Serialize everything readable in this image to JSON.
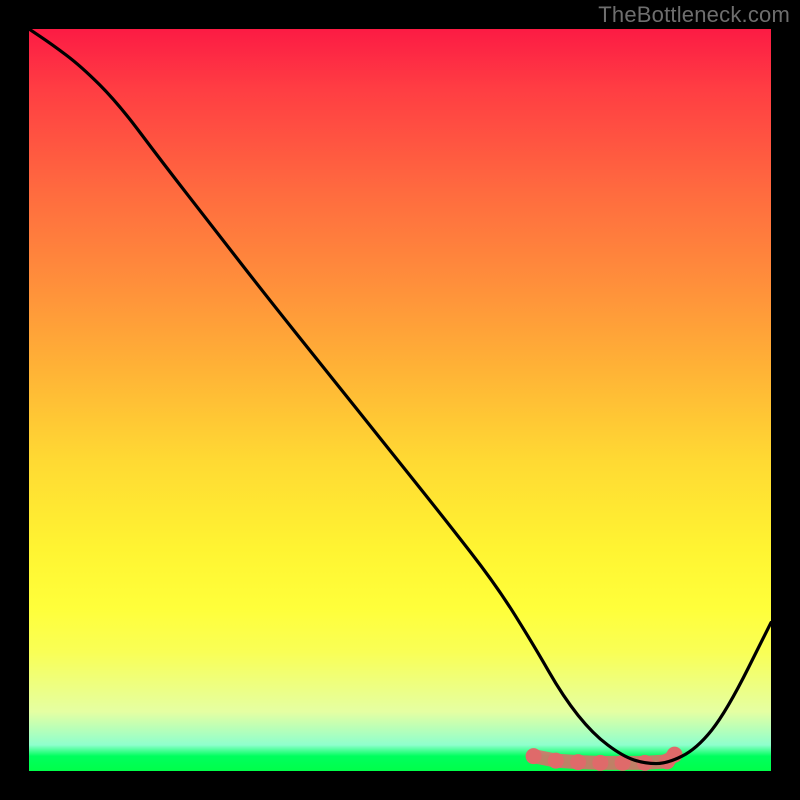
{
  "attribution": "TheBottleneck.com",
  "chart_data": {
    "type": "line",
    "title": "",
    "xlabel": "",
    "ylabel": "",
    "xlim": [
      0,
      100
    ],
    "ylim": [
      0,
      100
    ],
    "x": [
      0,
      3,
      7,
      12,
      18,
      25,
      32,
      40,
      48,
      56,
      63,
      68,
      72,
      76,
      80,
      83,
      86,
      90,
      94,
      100
    ],
    "values": [
      100,
      98,
      95,
      90,
      82,
      73,
      64,
      54,
      44,
      34,
      25,
      17,
      10,
      5,
      2,
      1,
      1,
      3,
      8,
      20
    ],
    "series": [
      {
        "name": "curve",
        "x": [
          0,
          3,
          7,
          12,
          18,
          25,
          32,
          40,
          48,
          56,
          63,
          68,
          72,
          76,
          80,
          83,
          86,
          90,
          94,
          100
        ],
        "y": [
          100,
          98,
          95,
          90,
          82,
          73,
          64,
          54,
          44,
          34,
          25,
          17,
          10,
          5,
          2,
          1,
          1,
          3,
          8,
          20
        ]
      }
    ],
    "markers": {
      "name": "highlight-band",
      "x": [
        68,
        71,
        74,
        77,
        80,
        83,
        86,
        87
      ],
      "y": [
        2.0,
        1.4,
        1.2,
        1.1,
        1.1,
        1.1,
        1.3,
        2.2
      ]
    },
    "background": {
      "type": "vertical-gradient",
      "stops": [
        {
          "pos": 0,
          "color": "#fc1b44"
        },
        {
          "pos": 22,
          "color": "#ff6b3f"
        },
        {
          "pos": 46,
          "color": "#ffb336"
        },
        {
          "pos": 70,
          "color": "#fff432"
        },
        {
          "pos": 92,
          "color": "#e5ffa2"
        },
        {
          "pos": 100,
          "color": "#00ff4a"
        }
      ]
    }
  }
}
